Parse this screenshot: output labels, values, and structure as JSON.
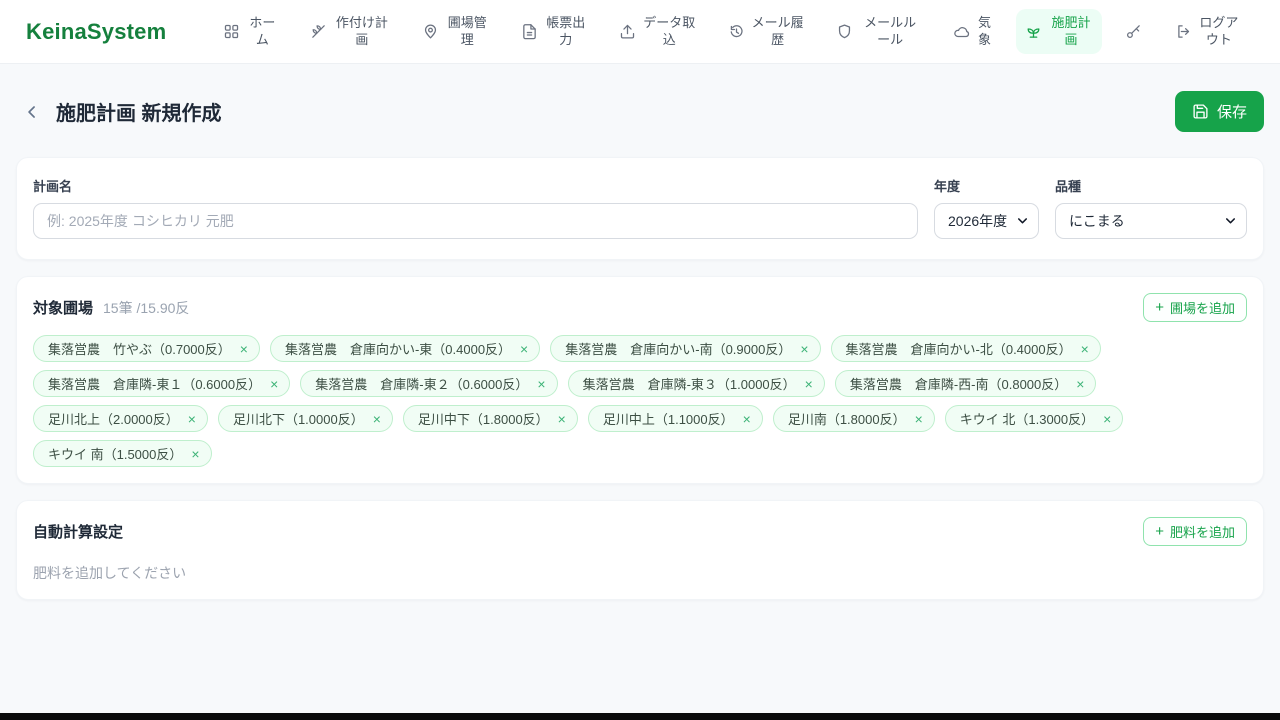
{
  "app": {
    "logo": "KeinaSystem"
  },
  "colors": {
    "brand_green": "#16a34a",
    "logo_green": "#15803d",
    "active_nav_bg": "#ecfdf5",
    "chip_bg": "#f1fdf5",
    "chip_border": "#bfefcd",
    "page_bg": "#f7f9fb"
  },
  "nav": {
    "items": [
      {
        "label": "ホーム",
        "icon": "grid-icon",
        "active": false
      },
      {
        "label": "作付け計画",
        "icon": "wheat-icon",
        "active": false
      },
      {
        "label": "圃場管理",
        "icon": "map-pin-icon",
        "active": false
      },
      {
        "label": "帳票出力",
        "icon": "document-icon",
        "active": false
      },
      {
        "label": "データ取込",
        "icon": "upload-icon",
        "active": false
      },
      {
        "label": "メール履歴",
        "icon": "history-icon",
        "active": false
      },
      {
        "label": "メールルール",
        "icon": "shield-icon",
        "active": false
      },
      {
        "label": "気象",
        "icon": "cloud-icon",
        "active": false
      },
      {
        "label": "施肥計画",
        "icon": "sprout-icon",
        "active": true
      }
    ],
    "key_item": {
      "icon": "key-icon"
    },
    "logout": {
      "label": "ログアウト",
      "icon": "logout-icon"
    }
  },
  "header": {
    "back_icon": "chevron-left-icon",
    "title": "施肥計画 新規作成",
    "save": {
      "icon": "save-icon",
      "label": "保存"
    }
  },
  "form": {
    "plan_name": {
      "label": "計画名",
      "placeholder": "例: 2025年度 コシヒカリ 元肥",
      "value": ""
    },
    "year": {
      "label": "年度",
      "value": "2026年度"
    },
    "variety": {
      "label": "品種",
      "value": "にこまる"
    }
  },
  "fields_section": {
    "title": "対象圃場",
    "summary": "15筆 /15.90反",
    "add_button": {
      "plus": "+",
      "label": "圃場を追加"
    },
    "chip_close_glyph": "×",
    "chips": [
      {
        "label": "集落営農　竹やぶ（0.7000反）"
      },
      {
        "label": "集落営農　倉庫向かい-東（0.4000反）"
      },
      {
        "label": "集落営農　倉庫向かい-南（0.9000反）"
      },
      {
        "label": "集落営農　倉庫向かい-北（0.4000反）"
      },
      {
        "label": "集落営農　倉庫隣-東１（0.6000反）"
      },
      {
        "label": "集落営農　倉庫隣-東２（0.6000反）"
      },
      {
        "label": "集落営農　倉庫隣-東３（1.0000反）"
      },
      {
        "label": "集落営農　倉庫隣-西-南（0.8000反）"
      },
      {
        "label": "足川北上（2.0000反）"
      },
      {
        "label": "足川北下（1.0000反）"
      },
      {
        "label": "足川中下（1.8000反）"
      },
      {
        "label": "足川中上（1.1000反）"
      },
      {
        "label": "足川南（1.8000反）"
      },
      {
        "label": "キウイ 北（1.3000反）"
      },
      {
        "label": "キウイ 南（1.5000反）"
      }
    ]
  },
  "calc_section": {
    "title": "自動計算設定",
    "add_button": {
      "plus": "+",
      "label": "肥料を追加"
    },
    "empty_text": "肥料を追加してください"
  }
}
